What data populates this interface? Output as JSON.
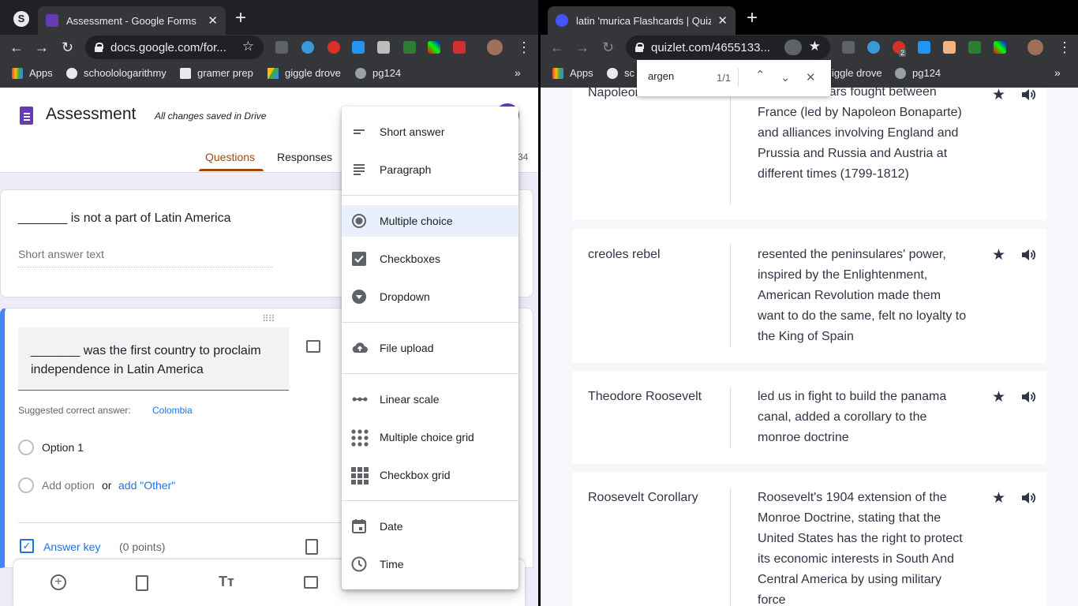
{
  "left_window": {
    "tab": {
      "title": "Assessment - Google Forms",
      "close": "✕"
    },
    "new_tab": "+",
    "address": "docs.google.com/for...",
    "bookmarks": [
      "Apps",
      "schoolologarithmy",
      "gramer prep",
      "giggle drove",
      "pg124"
    ],
    "form": {
      "title": "Assessment",
      "save_status": "All changes saved in Drive",
      "tabs": [
        "Questions",
        "Responses"
      ],
      "total_points_fragment": "34",
      "question1": {
        "text": "_______ is not a part of Latin America",
        "placeholder": "Short answer text"
      },
      "question2": {
        "text": "_______ was the first country to proclaim independence in Latin America",
        "suggested_label": "Suggested correct answer:",
        "suggested_value": "Colombia",
        "option1": "Option 1",
        "add_option": "Add option",
        "or": "or",
        "add_other": "add \"Other\"",
        "answer_key": "Answer key",
        "points": "(0 points)"
      }
    },
    "type_menu": {
      "items": [
        "Short answer",
        "Paragraph",
        "Multiple choice",
        "Checkboxes",
        "Dropdown",
        "File upload",
        "Linear scale",
        "Multiple choice grid",
        "Checkbox grid",
        "Date",
        "Time"
      ],
      "selected": "Multiple choice"
    }
  },
  "right_window": {
    "tab": {
      "title": "latin 'murica Flashcards | Quizl",
      "close": "✕"
    },
    "new_tab": "+",
    "address": "quizlet.com/4655133...",
    "bookmarks": [
      "Apps",
      "sc",
      "iggle drove",
      "pg124"
    ],
    "extension_badge": "2",
    "find": {
      "query": "argen",
      "count": "1/1"
    },
    "cards": [
      {
        "term": "Napoleonic Wars",
        "definition": "A series of wars fought between France (led by Napoleon Bonaparte) and alliances involving England and Prussia and Russia and Austria at different times (1799-1812)"
      },
      {
        "term": "creoles rebel",
        "definition": "resented the peninsulares' power, inspired by the Enlightenment, American Revolution made them want to do the same, felt no loyalty to the King of Spain"
      },
      {
        "term": "Theodore Roosevelt",
        "definition": "led us in fight to build the panama canal, added a corollary to the monroe doctrine"
      },
      {
        "term": "Roosevelt Corollary",
        "definition": "Roosevelt's 1904 extension of the Monroe Doctrine, stating that the United States has the right to protect its economic interests in South And Central America by using military force"
      }
    ]
  },
  "colors": {
    "forms_purple": "#673ab7",
    "forms_tab_active": "#a6470b",
    "link_blue": "#1a73e8",
    "menu_selected": "#e8f0fe",
    "chrome_dark": "#202124",
    "chrome_toolbar": "#35363a"
  }
}
